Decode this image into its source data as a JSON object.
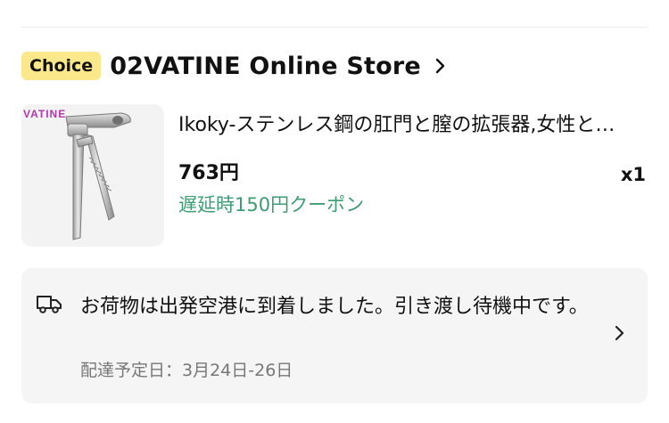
{
  "store": {
    "badge": "Choice",
    "name": "02VATINE Online Store"
  },
  "product": {
    "image_logo": "VATINE",
    "title": "Ikoky-ステンレス鋼の肛門と膣の拡張器,女性と…",
    "price": "763円",
    "coupon": "遅延時150円クーポン",
    "quantity": "x1"
  },
  "shipping": {
    "status": "お荷物は出発空港に到着しました。引き渡し待機中です。",
    "estimated_delivery": "配達予定日：3月24日-26日"
  },
  "colors": {
    "choice_badge": "#fbe88a",
    "coupon_green": "#3d9d73",
    "card_bg": "#f5f5f5",
    "muted_text": "#777777"
  },
  "icons": [
    "chevron-right-icon",
    "delivery-truck-icon"
  ]
}
